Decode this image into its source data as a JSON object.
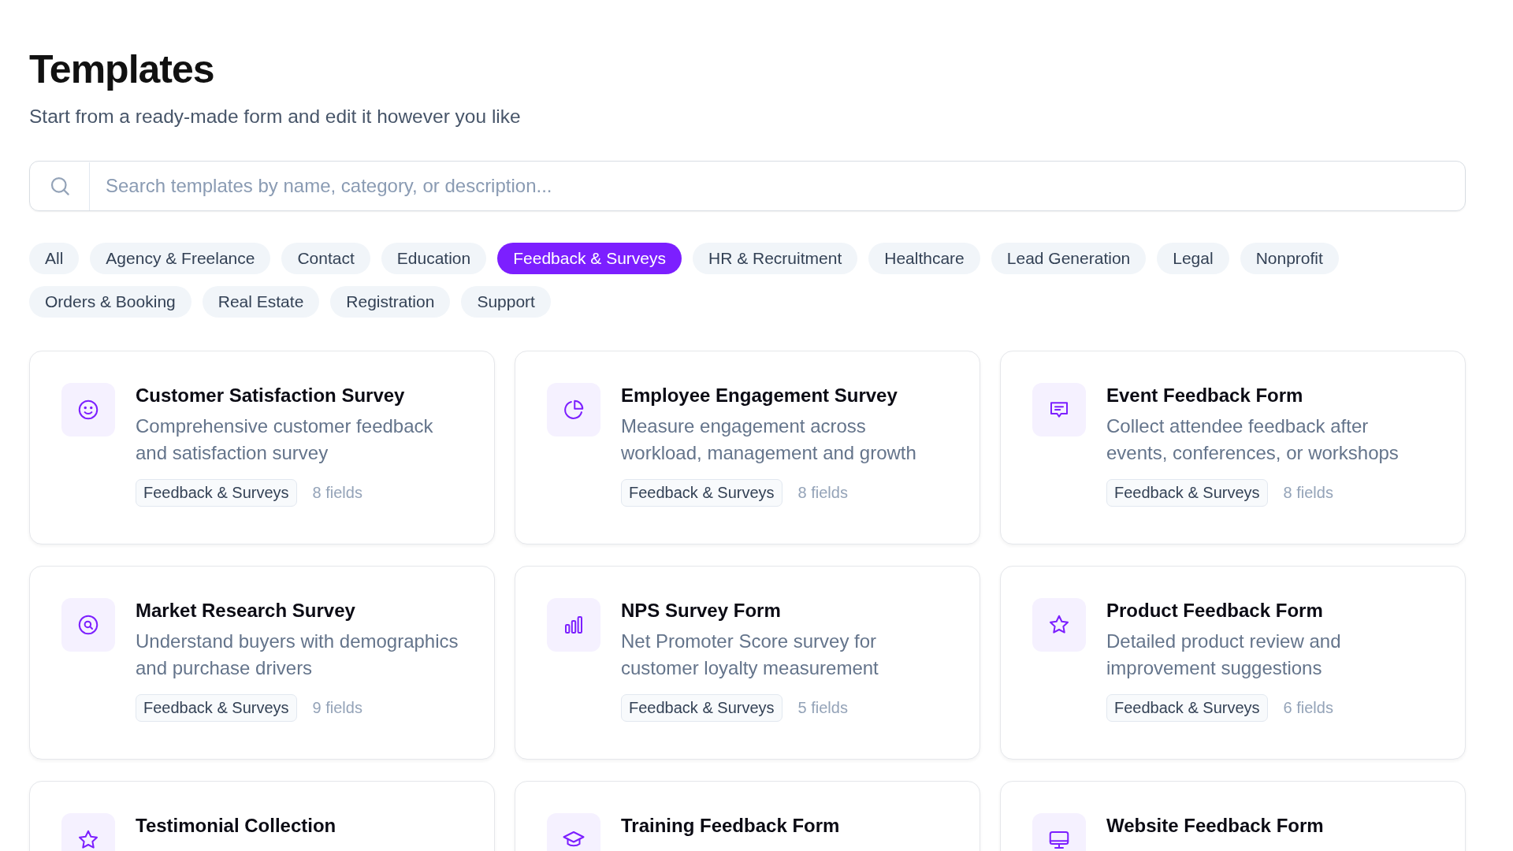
{
  "header": {
    "title": "Templates",
    "subtitle": "Start from a ready-made form and edit it however you like"
  },
  "search": {
    "placeholder": "Search templates by name, category, or description..."
  },
  "categories": [
    {
      "label": "All",
      "selected": false
    },
    {
      "label": "Agency & Freelance",
      "selected": false
    },
    {
      "label": "Contact",
      "selected": false
    },
    {
      "label": "Education",
      "selected": false
    },
    {
      "label": "Feedback & Surveys",
      "selected": true
    },
    {
      "label": "HR & Recruitment",
      "selected": false
    },
    {
      "label": "Healthcare",
      "selected": false
    },
    {
      "label": "Lead Generation",
      "selected": false
    },
    {
      "label": "Legal",
      "selected": false
    },
    {
      "label": "Nonprofit",
      "selected": false
    },
    {
      "label": "Orders & Booking",
      "selected": false
    },
    {
      "label": "Real Estate",
      "selected": false
    },
    {
      "label": "Registration",
      "selected": false
    },
    {
      "label": "Support",
      "selected": false
    }
  ],
  "templates": [
    {
      "kind": "smile",
      "title": "Customer Satisfaction Survey",
      "description": "Comprehensive customer feedback and satisfaction survey",
      "tag": "Feedback & Surveys",
      "fields": "8 fields"
    },
    {
      "kind": "pie",
      "title": "Employee Engagement Survey",
      "description": "Measure engagement across workload, management and growth",
      "tag": "Feedback & Surveys",
      "fields": "8 fields"
    },
    {
      "kind": "message",
      "title": "Event Feedback Form",
      "description": "Collect attendee feedback after events, conferences, or workshops",
      "tag": "Feedback & Surveys",
      "fields": "8 fields"
    },
    {
      "kind": "search",
      "title": "Market Research Survey",
      "description": "Understand buyers with demographics and purchase drivers",
      "tag": "Feedback & Surveys",
      "fields": "9 fields"
    },
    {
      "kind": "bars",
      "title": "NPS Survey Form",
      "description": "Net Promoter Score survey for customer loyalty measurement",
      "tag": "Feedback & Surveys",
      "fields": "5 fields"
    },
    {
      "kind": "star",
      "title": "Product Feedback Form",
      "description": "Detailed product review and improvement suggestions",
      "tag": "Feedback & Surveys",
      "fields": "6 fields"
    },
    {
      "kind": "star",
      "title": "Testimonial Collection"
    },
    {
      "kind": "cap",
      "title": "Training Feedback Form"
    },
    {
      "kind": "monitor",
      "title": "Website Feedback Form"
    }
  ]
}
